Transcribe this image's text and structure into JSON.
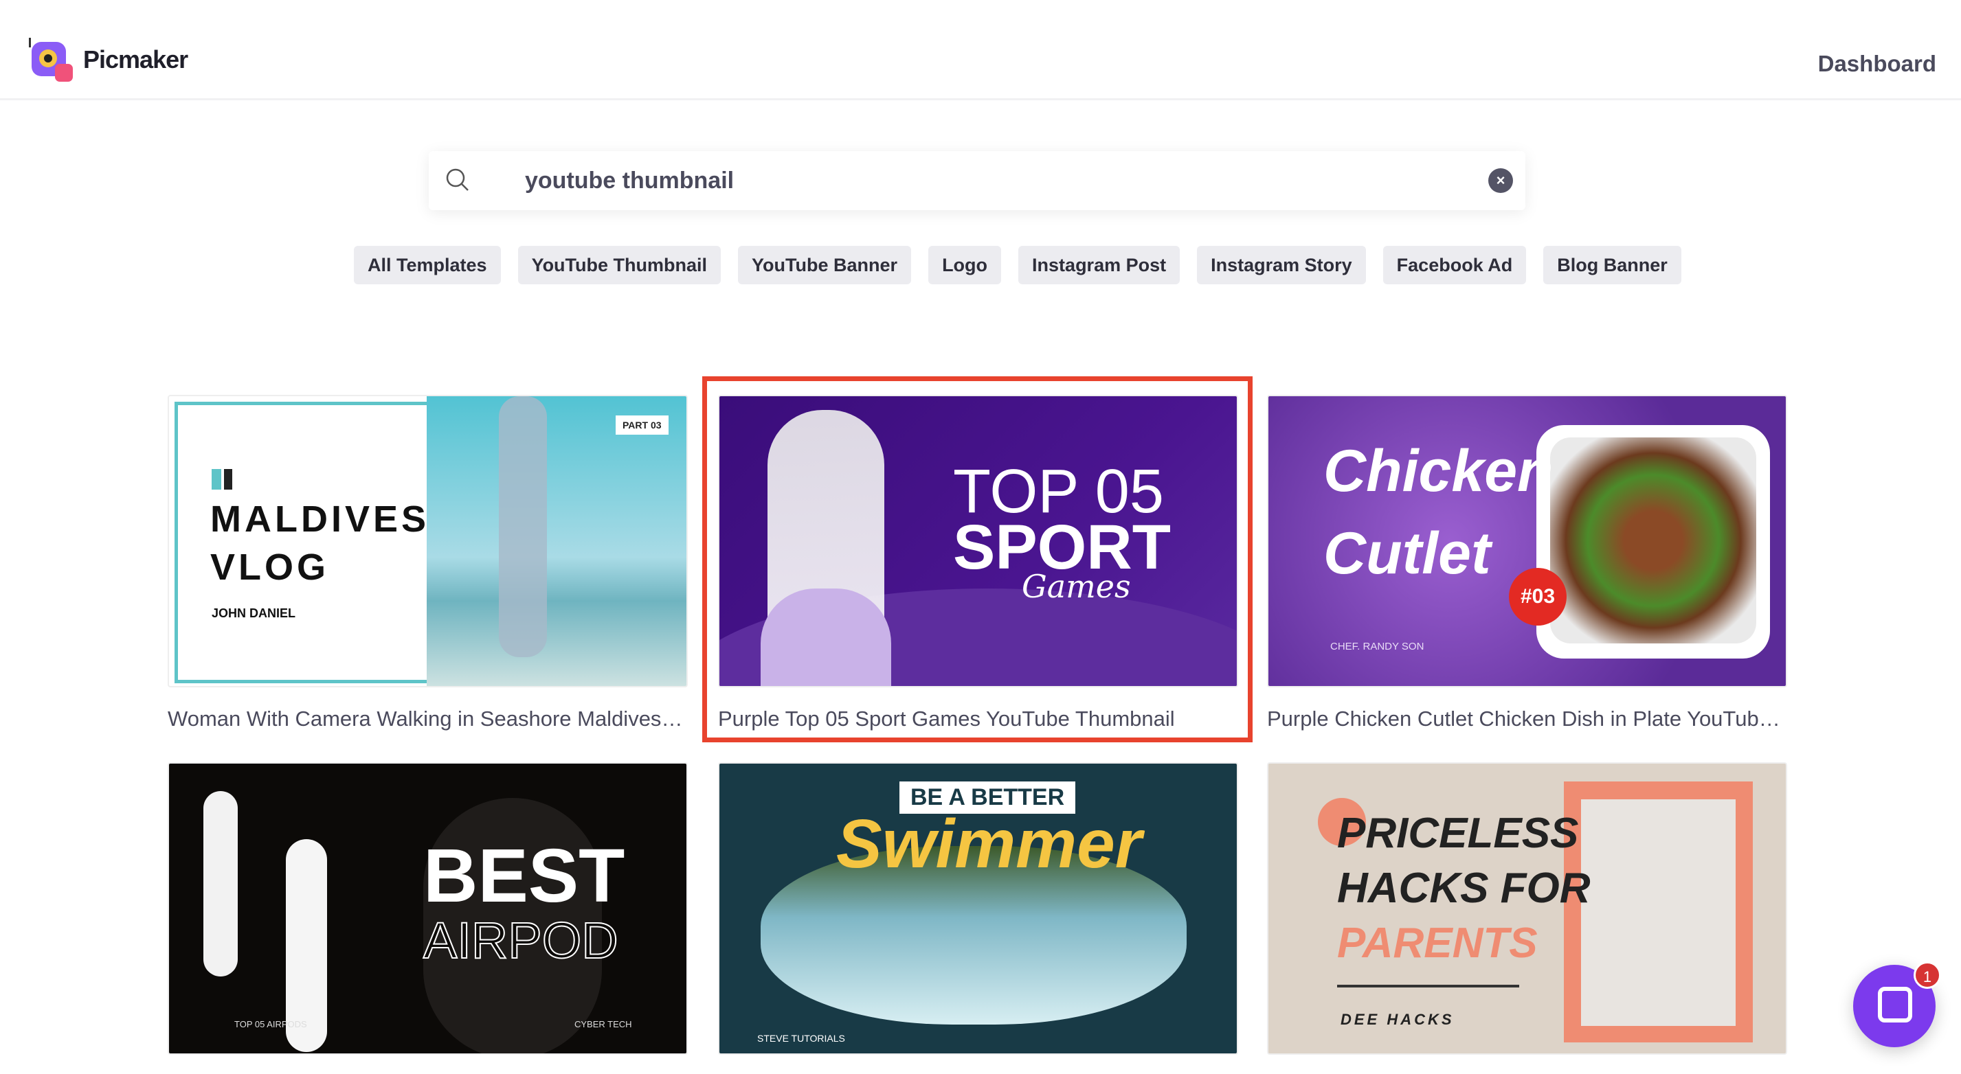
{
  "header": {
    "brand": "Picmaker",
    "dashboard": "Dashboard"
  },
  "search": {
    "value": "youtube thumbnail",
    "icon": "search-icon",
    "clear_icon": "close-circle-icon"
  },
  "filters": [
    "All Templates",
    "YouTube Thumbnail",
    "YouTube Banner",
    "Logo",
    "Instagram Post",
    "Instagram Story",
    "Facebook Ad",
    "Blog Banner"
  ],
  "templates": [
    {
      "caption": "Woman With Camera Walking in Seashore Maldives Is...",
      "art": {
        "line1": "MALDIVES",
        "line2": "VLOG",
        "author": "JOHN DANIEL",
        "tag": "PART 03"
      }
    },
    {
      "caption": "Purple Top 05 Sport Games YouTube Thumbnail",
      "art": {
        "line1": "TOP 05",
        "line2": "SPORT",
        "line3": "Games"
      },
      "selected": true
    },
    {
      "caption": "Purple Chicken Cutlet Chicken Dish in Plate YouTube ...",
      "art": {
        "line1": "Chicken",
        "line2": "Cutlet",
        "badge": "#03",
        "author": "CHEF. RANDY SON"
      }
    },
    {
      "caption": "",
      "art": {
        "line1": "BEST",
        "line2": "AIRPOD",
        "left": "TOP 05 AIRPODS",
        "right": "CYBER TECH"
      }
    },
    {
      "caption": "",
      "art": {
        "line1": "BE A BETTER",
        "line2": "Swimmer",
        "author": "STEVE TUTORIALS"
      }
    },
    {
      "caption": "",
      "art": {
        "line1": "PRICELESS",
        "line2": "HACKS FOR",
        "line3": "PARENTS",
        "author": "DEE HACKS"
      }
    }
  ],
  "chat": {
    "badge": "1"
  },
  "colors": {
    "highlight": "#e8432e",
    "chat": "#7c3aed",
    "chip_bg": "#ececf0"
  }
}
